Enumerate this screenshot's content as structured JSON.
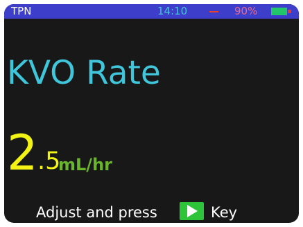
{
  "status_bar": {
    "channel": "TPN",
    "time": "14:10",
    "battery_percent": "90%",
    "battery_level": 0.9,
    "colors": {
      "background": "#3d3fcb",
      "time": "#49c3dc",
      "battery_text": "#e86a90",
      "battery_fill": "#22c66b",
      "dash": "#e8402e"
    }
  },
  "main": {
    "title": "KVO Rate",
    "value_integer": "2",
    "value_decimal": ".5",
    "unit": "mL/hr",
    "colors": {
      "title": "#3fc6db",
      "value": "#f2f215",
      "unit": "#69b52d"
    }
  },
  "instruction": {
    "text_before": "Adjust and press",
    "icon": "play-icon",
    "text_after": "Key"
  }
}
